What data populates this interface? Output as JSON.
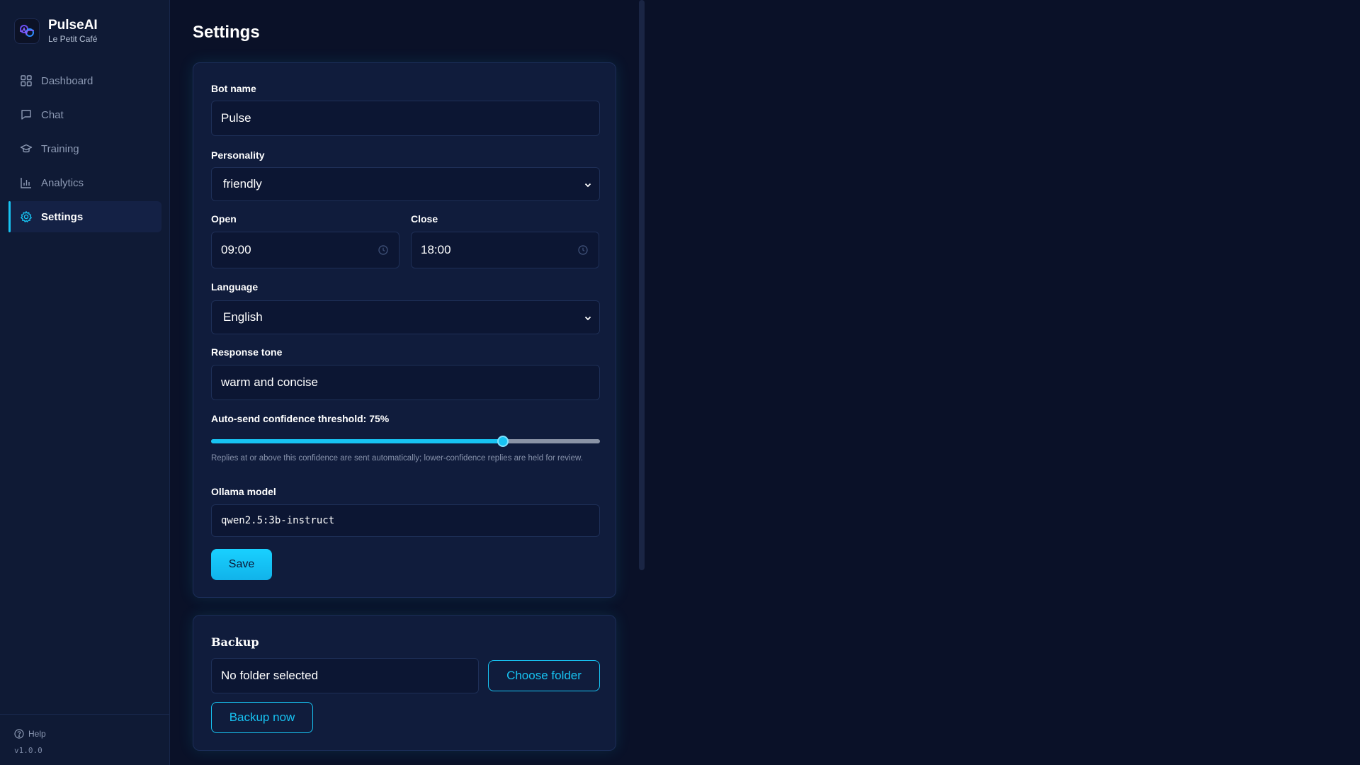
{
  "brand": {
    "name": "PulseAI",
    "subtitle": "Le Petit Café"
  },
  "nav": [
    {
      "label": "Dashboard",
      "icon": "dashboard-icon"
    },
    {
      "label": "Chat",
      "icon": "chat-icon"
    },
    {
      "label": "Training",
      "icon": "graduation-cap-icon"
    },
    {
      "label": "Analytics",
      "icon": "bar-chart-icon"
    },
    {
      "label": "Settings",
      "icon": "gear-icon",
      "active": true
    }
  ],
  "footer": {
    "help": "Help",
    "version": "v1.0.0"
  },
  "page": {
    "title": "Settings"
  },
  "settings": {
    "bot_name_label": "Bot name",
    "bot_name": "Pulse",
    "personality_label": "Personality",
    "personality": "friendly",
    "open_label": "Open",
    "open_time": "09:00",
    "close_label": "Close",
    "close_time": "18:00",
    "language_label": "Language",
    "language": "English",
    "tone_label": "Response tone",
    "tone": "warm and concise",
    "threshold_label": "Auto-send confidence threshold: 75%",
    "threshold_value": 0.75,
    "threshold_hint": "Replies at or above this confidence are sent automatically; lower-confidence replies are held for review.",
    "model_label": "Ollama model",
    "model": "qwen2.5:3b-instruct",
    "save": "Save"
  },
  "backup": {
    "title": "Backup",
    "folder": "No folder selected",
    "choose": "Choose folder",
    "backup_now": "Backup now"
  },
  "colors": {
    "accent": "#17c3f2",
    "background": "#0a1128",
    "sidebar": "#0f1a35",
    "card": "#101c3c"
  }
}
